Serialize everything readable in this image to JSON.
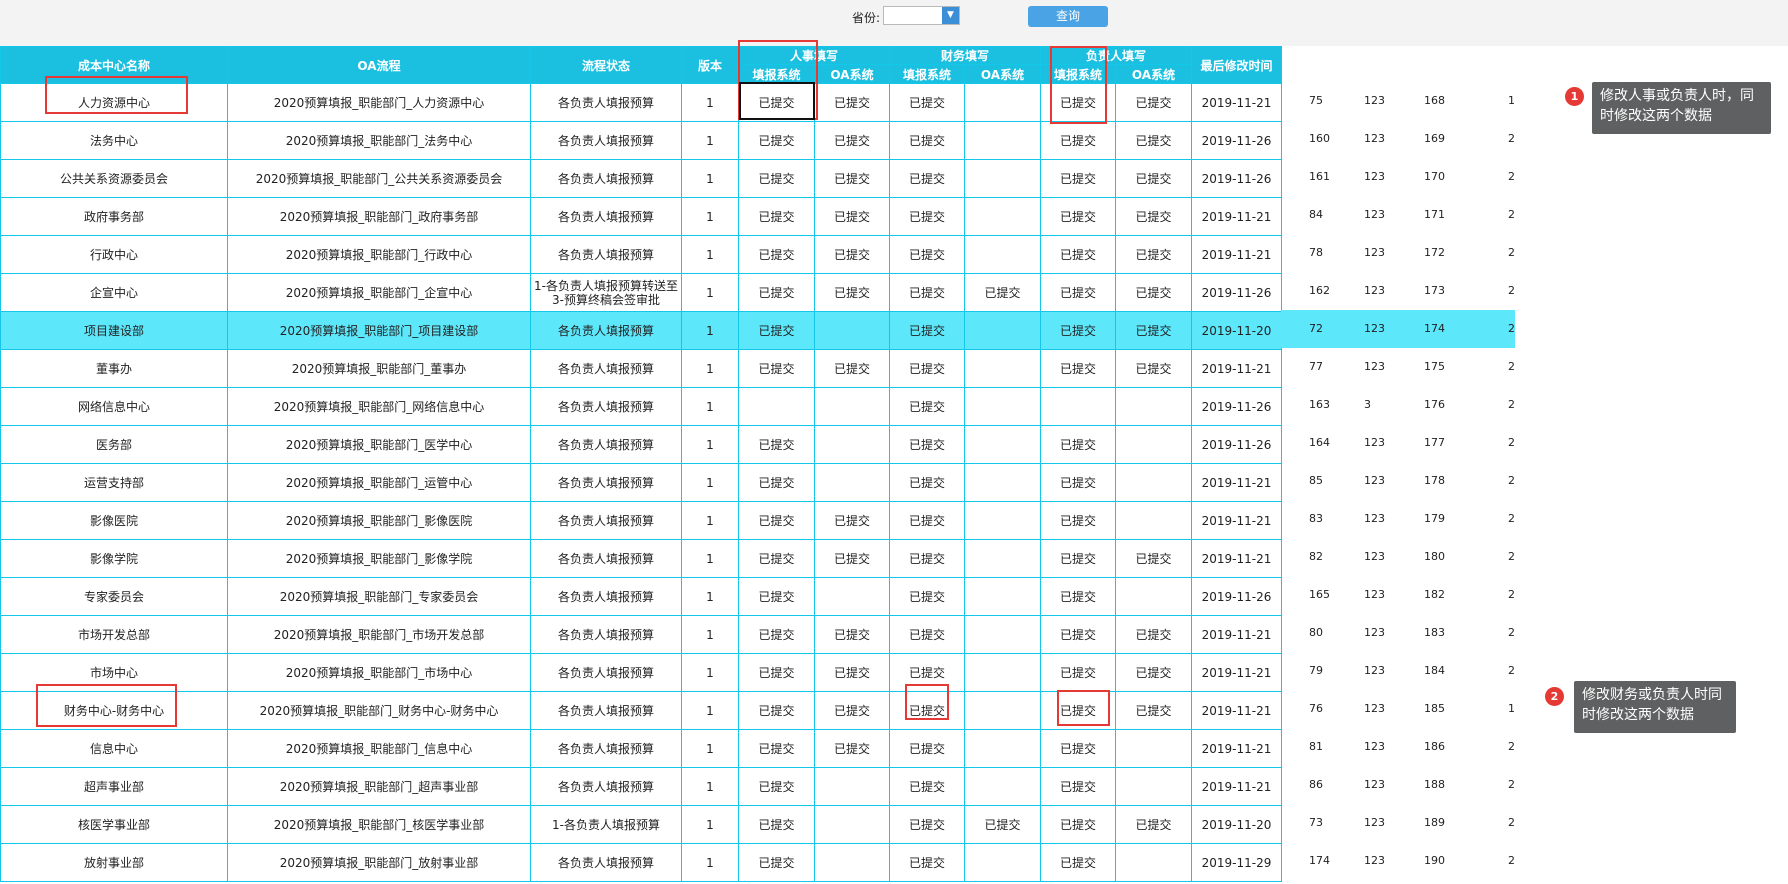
{
  "toolbar": {
    "province_label": "省份:",
    "province_value": "",
    "query_button": "查询"
  },
  "header": {
    "cost_center": "成本中心名称",
    "oa_flow": "OA流程",
    "flow_status": "流程状态",
    "version": "版本",
    "hr_group": "人事填写",
    "fin_group": "财务填写",
    "owner_group": "负责人填写",
    "fill_system": "填报系统",
    "oa_system": "OA系统",
    "last_modified": "最后修改时间"
  },
  "rows": [
    {
      "name": "人力资源中心",
      "flow": "2020预算填报_职能部门_人力资源中心",
      "status": "各负责人填报预算",
      "ver": "1",
      "hr_fill": "已提交",
      "hr_oa": "已提交",
      "fin_fill": "已提交",
      "fin_oa": "",
      "own_fill": "已提交",
      "own_oa": "已提交",
      "date": "2019-11-21",
      "c1": "75",
      "c2": "123",
      "c3": "168",
      "c4": "1"
    },
    {
      "name": "法务中心",
      "flow": "2020预算填报_职能部门_法务中心",
      "status": "各负责人填报预算",
      "ver": "1",
      "hr_fill": "已提交",
      "hr_oa": "已提交",
      "fin_fill": "已提交",
      "fin_oa": "",
      "own_fill": "已提交",
      "own_oa": "已提交",
      "date": "2019-11-26",
      "c1": "160",
      "c2": "123",
      "c3": "169",
      "c4": "2"
    },
    {
      "name": "公共关系资源委员会",
      "flow": "2020预算填报_职能部门_公共关系资源委员会",
      "status": "各负责人填报预算",
      "ver": "1",
      "hr_fill": "已提交",
      "hr_oa": "已提交",
      "fin_fill": "已提交",
      "fin_oa": "",
      "own_fill": "已提交",
      "own_oa": "已提交",
      "date": "2019-11-26",
      "c1": "161",
      "c2": "123",
      "c3": "170",
      "c4": "2"
    },
    {
      "name": "政府事务部",
      "flow": "2020预算填报_职能部门_政府事务部",
      "status": "各负责人填报预算",
      "ver": "1",
      "hr_fill": "已提交",
      "hr_oa": "已提交",
      "fin_fill": "已提交",
      "fin_oa": "",
      "own_fill": "已提交",
      "own_oa": "已提交",
      "date": "2019-11-21",
      "c1": "84",
      "c2": "123",
      "c3": "171",
      "c4": "2"
    },
    {
      "name": "行政中心",
      "flow": "2020预算填报_职能部门_行政中心",
      "status": "各负责人填报预算",
      "ver": "1",
      "hr_fill": "已提交",
      "hr_oa": "已提交",
      "fin_fill": "已提交",
      "fin_oa": "",
      "own_fill": "已提交",
      "own_oa": "已提交",
      "date": "2019-11-21",
      "c1": "78",
      "c2": "123",
      "c3": "172",
      "c4": "2"
    },
    {
      "name": "企宣中心",
      "flow": "2020预算填报_职能部门_企宣中心",
      "status": "1-各负责人填报预算转送至3-预算终稿会签审批",
      "ver": "1",
      "hr_fill": "已提交",
      "hr_oa": "已提交",
      "fin_fill": "已提交",
      "fin_oa": "已提交",
      "own_fill": "已提交",
      "own_oa": "已提交",
      "date": "2019-11-26",
      "c1": "162",
      "c2": "123",
      "c3": "173",
      "c4": "2"
    },
    {
      "name": "项目建设部",
      "flow": "2020预算填报_职能部门_项目建设部",
      "status": "各负责人填报预算",
      "ver": "1",
      "hr_fill": "已提交",
      "hr_oa": "",
      "fin_fill": "已提交",
      "fin_oa": "",
      "own_fill": "已提交",
      "own_oa": "已提交",
      "date": "2019-11-20",
      "c1": "72",
      "c2": "123",
      "c3": "174",
      "c4": "2"
    },
    {
      "name": "董事办",
      "flow": "2020预算填报_职能部门_董事办",
      "status": "各负责人填报预算",
      "ver": "1",
      "hr_fill": "已提交",
      "hr_oa": "已提交",
      "fin_fill": "已提交",
      "fin_oa": "",
      "own_fill": "已提交",
      "own_oa": "已提交",
      "date": "2019-11-21",
      "c1": "77",
      "c2": "123",
      "c3": "175",
      "c4": "2"
    },
    {
      "name": "网络信息中心",
      "flow": "2020预算填报_职能部门_网络信息中心",
      "status": "各负责人填报预算",
      "ver": "1",
      "hr_fill": "",
      "hr_oa": "",
      "fin_fill": "已提交",
      "fin_oa": "",
      "own_fill": "",
      "own_oa": "",
      "date": "2019-11-26",
      "c1": "163",
      "c2": "3",
      "c3": "176",
      "c4": "2"
    },
    {
      "name": "医务部",
      "flow": "2020预算填报_职能部门_医学中心",
      "status": "各负责人填报预算",
      "ver": "1",
      "hr_fill": "已提交",
      "hr_oa": "",
      "fin_fill": "已提交",
      "fin_oa": "",
      "own_fill": "已提交",
      "own_oa": "",
      "date": "2019-11-26",
      "c1": "164",
      "c2": "123",
      "c3": "177",
      "c4": "2"
    },
    {
      "name": "运营支持部",
      "flow": "2020预算填报_职能部门_运管中心",
      "status": "各负责人填报预算",
      "ver": "1",
      "hr_fill": "已提交",
      "hr_oa": "",
      "fin_fill": "已提交",
      "fin_oa": "",
      "own_fill": "已提交",
      "own_oa": "",
      "date": "2019-11-21",
      "c1": "85",
      "c2": "123",
      "c3": "178",
      "c4": "2"
    },
    {
      "name": "影像医院",
      "flow": "2020预算填报_职能部门_影像医院",
      "status": "各负责人填报预算",
      "ver": "1",
      "hr_fill": "已提交",
      "hr_oa": "已提交",
      "fin_fill": "已提交",
      "fin_oa": "",
      "own_fill": "已提交",
      "own_oa": "",
      "date": "2019-11-21",
      "c1": "83",
      "c2": "123",
      "c3": "179",
      "c4": "2"
    },
    {
      "name": "影像学院",
      "flow": "2020预算填报_职能部门_影像学院",
      "status": "各负责人填报预算",
      "ver": "1",
      "hr_fill": "已提交",
      "hr_oa": "已提交",
      "fin_fill": "已提交",
      "fin_oa": "",
      "own_fill": "已提交",
      "own_oa": "已提交",
      "date": "2019-11-21",
      "c1": "82",
      "c2": "123",
      "c3": "180",
      "c4": "2"
    },
    {
      "name": "专家委员会",
      "flow": "2020预算填报_职能部门_专家委员会",
      "status": "各负责人填报预算",
      "ver": "1",
      "hr_fill": "已提交",
      "hr_oa": "",
      "fin_fill": "已提交",
      "fin_oa": "",
      "own_fill": "已提交",
      "own_oa": "",
      "date": "2019-11-26",
      "c1": "165",
      "c2": "123",
      "c3": "182",
      "c4": "2"
    },
    {
      "name": "市场开发总部",
      "flow": "2020预算填报_职能部门_市场开发总部",
      "status": "各负责人填报预算",
      "ver": "1",
      "hr_fill": "已提交",
      "hr_oa": "已提交",
      "fin_fill": "已提交",
      "fin_oa": "",
      "own_fill": "已提交",
      "own_oa": "已提交",
      "date": "2019-11-21",
      "c1": "80",
      "c2": "123",
      "c3": "183",
      "c4": "2"
    },
    {
      "name": "市场中心",
      "flow": "2020预算填报_职能部门_市场中心",
      "status": "各负责人填报预算",
      "ver": "1",
      "hr_fill": "已提交",
      "hr_oa": "已提交",
      "fin_fill": "已提交",
      "fin_oa": "",
      "own_fill": "已提交",
      "own_oa": "已提交",
      "date": "2019-11-21",
      "c1": "79",
      "c2": "123",
      "c3": "184",
      "c4": "2"
    },
    {
      "name": "财务中心-财务中心",
      "flow": "2020预算填报_职能部门_财务中心-财务中心",
      "status": "各负责人填报预算",
      "ver": "1",
      "hr_fill": "已提交",
      "hr_oa": "已提交",
      "fin_fill": "已提交",
      "fin_oa": "",
      "own_fill": "已提交",
      "own_oa": "已提交",
      "date": "2019-11-21",
      "c1": "76",
      "c2": "123",
      "c3": "185",
      "c4": "1"
    },
    {
      "name": "信息中心",
      "flow": "2020预算填报_职能部门_信息中心",
      "status": "各负责人填报预算",
      "ver": "1",
      "hr_fill": "已提交",
      "hr_oa": "已提交",
      "fin_fill": "已提交",
      "fin_oa": "",
      "own_fill": "已提交",
      "own_oa": "",
      "date": "2019-11-21",
      "c1": "81",
      "c2": "123",
      "c3": "186",
      "c4": "2"
    },
    {
      "name": "超声事业部",
      "flow": "2020预算填报_职能部门_超声事业部",
      "status": "各负责人填报预算",
      "ver": "1",
      "hr_fill": "已提交",
      "hr_oa": "",
      "fin_fill": "已提交",
      "fin_oa": "",
      "own_fill": "已提交",
      "own_oa": "",
      "date": "2019-11-21",
      "c1": "86",
      "c2": "123",
      "c3": "188",
      "c4": "2"
    },
    {
      "name": "核医学事业部",
      "flow": "2020预算填报_职能部门_核医学事业部",
      "status": "1-各负责人填报预算",
      "ver": "1",
      "hr_fill": "已提交",
      "hr_oa": "",
      "fin_fill": "已提交",
      "fin_oa": "已提交",
      "own_fill": "已提交",
      "own_oa": "已提交",
      "date": "2019-11-20",
      "c1": "73",
      "c2": "123",
      "c3": "189",
      "c4": "2"
    },
    {
      "name": "放射事业部",
      "flow": "2020预算填报_职能部门_放射事业部",
      "status": "各负责人填报预算",
      "ver": "1",
      "hr_fill": "已提交",
      "hr_oa": "",
      "fin_fill": "已提交",
      "fin_oa": "",
      "own_fill": "已提交",
      "own_oa": "",
      "date": "2019-11-29",
      "c1": "174",
      "c2": "123",
      "c3": "190",
      "c4": "2"
    }
  ],
  "annotations": {
    "note1": {
      "badge": "1",
      "text": "修改人事或负责人时，同时修改这两个数据"
    },
    "note2": {
      "badge": "2",
      "text": "修改财务或负责人时同时修改这两个数据"
    }
  },
  "colors": {
    "header_bg": "#1bbfe0",
    "border": "#13c7e8",
    "highlight_row": "#5de7fb",
    "annotation_red": "#e53935",
    "tooltip_bg": "#5f6061",
    "query_button": "#4aa3e4"
  },
  "highlighted_row": 6
}
